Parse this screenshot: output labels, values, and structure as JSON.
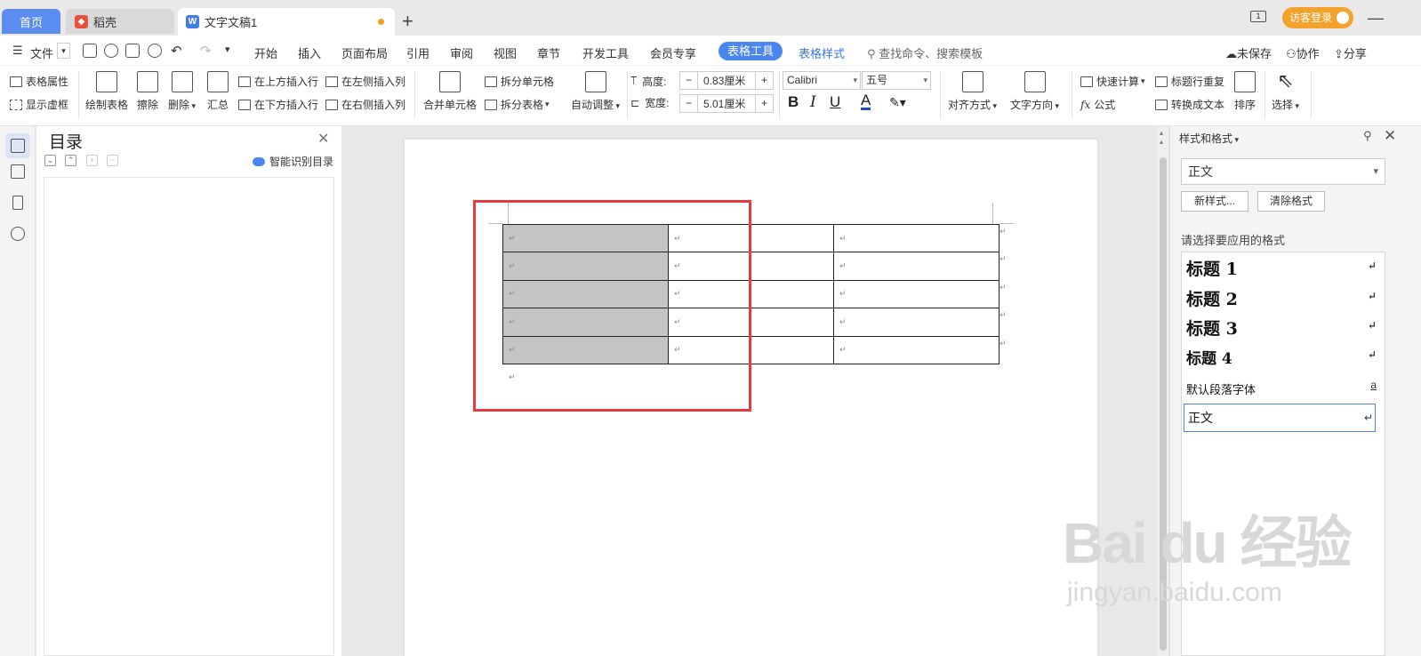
{
  "tabs": {
    "home": "首页",
    "daoke": "稻壳",
    "doc": "文字文稿1",
    "new_tab": "+"
  },
  "titlebar": {
    "window_icon": "1",
    "login": "访客登录",
    "minimize": "—"
  },
  "menubar": {
    "file": "文件",
    "items": [
      "开始",
      "插入",
      "页面布局",
      "引用",
      "审阅",
      "视图",
      "章节",
      "开发工具",
      "会员专享"
    ],
    "active_tab": "表格工具",
    "table_style": "表格样式",
    "search_placeholder": "查找命令、搜索模板",
    "unsaved": "未保存",
    "collab": "协作",
    "share": "分享"
  },
  "ribbon": {
    "table_props": "表格属性",
    "show_gridlines": "显示虚框",
    "draw_table": "绘制表格",
    "erase": "擦除",
    "delete": "删除",
    "summary": "汇总",
    "insert_row_above": "在上方插入行",
    "insert_row_below": "在下方插入行",
    "insert_col_left": "在左侧插入列",
    "insert_col_right": "在右侧插入列",
    "merge_cells": "合并单元格",
    "split_cell": "拆分单元格",
    "split_table": "拆分表格",
    "auto_fit": "自动调整",
    "height_label": "高度:",
    "height_value": "0.83厘米",
    "width_label": "宽度:",
    "width_value": "5.01厘米",
    "font_name": "Calibri",
    "font_size": "五号",
    "bold": "B",
    "italic": "I",
    "underline": "U",
    "font_color": "A",
    "align": "对齐方式",
    "text_direction": "文字方向",
    "quick_calc": "快速计算",
    "formula": "公式",
    "repeat_header": "标题行重复",
    "convert_text": "转换成文本",
    "sort": "排序",
    "select": "选择"
  },
  "toc": {
    "title": "目录",
    "ai_identify": "智能识别目录"
  },
  "document": {
    "table_rows": 5,
    "table_cols": 3,
    "cell_mark": "↵",
    "paragraph_mark": "↵"
  },
  "style_pane": {
    "title": "样式和格式",
    "current_style": "正文",
    "new_style": "新样式...",
    "clear_format": "清除格式",
    "prompt": "请选择要应用的格式",
    "styles": [
      {
        "label": "标题  1",
        "mark": "↵"
      },
      {
        "label": "标题  2",
        "mark": "↵"
      },
      {
        "label": "标题  3",
        "mark": "↵"
      },
      {
        "label": "标题  4",
        "mark": "↵"
      },
      {
        "label": "默认段落字体",
        "mark": "a"
      },
      {
        "label": "正文",
        "mark": "↵"
      }
    ]
  },
  "watermark": {
    "logo": "Bai du 经验",
    "url": "jingyan.baidu.com"
  },
  "colors": {
    "accent": "#4a86f0",
    "highlight_box": "#e83a3a",
    "selected_cell": "#c4c4c4",
    "login_button": "#f3a22a"
  }
}
